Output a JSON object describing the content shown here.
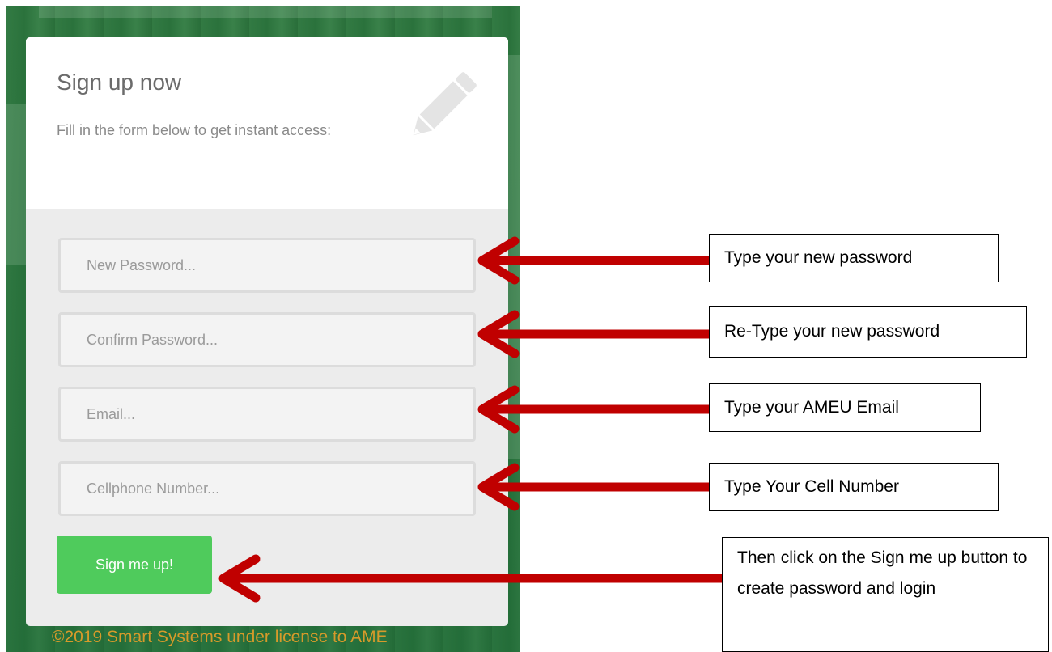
{
  "signup": {
    "title": "Sign up now",
    "subtitle": "Fill in the form below to get instant access:",
    "icon": "pencil-icon",
    "fields": {
      "new_password_placeholder": "New Password...",
      "confirm_password_placeholder": "Confirm Password...",
      "email_placeholder": "Email...",
      "cellphone_placeholder": "Cellphone Number..."
    },
    "button_label": "Sign me up!",
    "footer": "©2019 Smart Systems under license to AME"
  },
  "annotations": {
    "new_password": "Type your new password",
    "confirm_password": "Re-Type your new password",
    "email": "Type your AMEU Email",
    "cellphone": "Type Your Cell Number",
    "button": "Then click on the Sign me up button to create password and login"
  },
  "colors": {
    "arrow": "#c00000",
    "button": "#4fcb5c",
    "footer_text": "#d79a2a",
    "background_tint": "#3a7a48"
  }
}
